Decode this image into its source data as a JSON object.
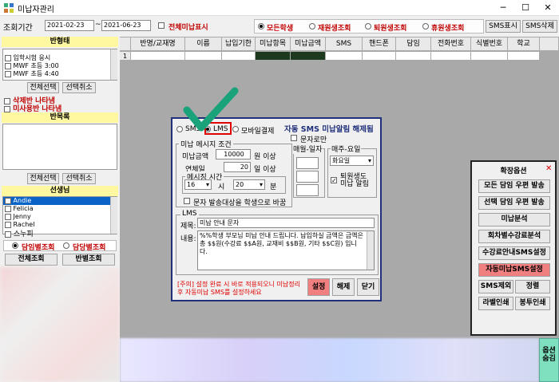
{
  "window": {
    "title": "미납자관리",
    "minimize": "─",
    "maximize": "☐",
    "close": "✕"
  },
  "toolbar": {
    "period_label": "조회기간",
    "date_from": "2021-02-23",
    "date_sep": "~",
    "date_to": "2021-06-23",
    "show_all_unpaid": "전체미납표시",
    "radios": [
      "모든학생",
      "재원생조회",
      "퇴원생조회",
      "휴원생조회"
    ],
    "sms_show": "SMS표시",
    "sms_delete": "SMS삭제"
  },
  "sidebar": {
    "class_header": "반형태",
    "class_items": [
      "입학시험 응시",
      "MWF 초등 3:00",
      "MWF 초등 4:40"
    ],
    "select_all": "전체선택",
    "deselect": "선택취소",
    "deleted_classes": "삭제반 나타냄",
    "unused_classes": "미사용반 나타냄",
    "section_header": "반목록",
    "select_all2": "전체선택",
    "deselect2": "선택취소",
    "teacher_header": "선생님",
    "teachers": [
      "Andie",
      "Felicia",
      "Jenny",
      "Rachel",
      "스누피"
    ],
    "by_teacher": "담임별조회",
    "by_charge": "담당별조회",
    "view_all": "전체조회",
    "by_class": "반별조회"
  },
  "grid": {
    "columns": [
      "반명/교재명",
      "이름",
      "납입기한",
      "미납항목",
      "미납금액",
      "SMS",
      "핸드폰",
      "담임",
      "전화번호",
      "식별번호",
      "학교"
    ],
    "row_num": "1"
  },
  "dialog": {
    "title": "자동 SMS 미납알림 해제됨",
    "radio_sms": "SMS",
    "radio_lms": "LMS",
    "radio_mobile": "모바일결제",
    "text_only": "문자로만",
    "unpaid_group": "미납 메시지 조건",
    "unpaid_amount_label": "미납금액",
    "unpaid_amount": "10000",
    "unpaid_amount_unit": "원 이상",
    "overdue_label": "연체일",
    "overdue_days": "20",
    "overdue_unit": "일 이상",
    "send_time_group": "메시징 시간",
    "hour": "16",
    "hour_unit": "시",
    "minute": "20",
    "minute_unit": "분",
    "send_target": "문자 발송대상을 학생으로 바꿈",
    "monthly_group": "매월-일자",
    "weekly_group": "매주-요일",
    "weekday": "화요일",
    "withdrawn_alert": "퇴원생도 미납 알림",
    "lms_group": "LMS",
    "subject_label": "제목:",
    "subject": "미납 안내 문자",
    "content_label": "내용:",
    "content": "%%학생 부모님 미납 안내 드립니다. 납입하실 금액은 금액은 총 $$원(수강료 $$A원, 교재비 $$B원, 기타 $$C원) 입니다.",
    "notice": "[주의] 설정 완료 시 바로 적용되오니 미납정리 후 자동미납 SMS를 설정하세요",
    "btn_set": "설정",
    "btn_release": "해제",
    "btn_close": "닫기"
  },
  "ext_panel": {
    "title": "확장옵션",
    "close": "✕",
    "buttons": [
      "모든 담임 우편 발송",
      "선택 담임 우편 발송",
      "미납분석",
      "회차별수강료분석",
      "수강료안내SMS설정",
      "자동미납SMS설정",
      "SMS제외",
      "정렬",
      "라벨인쇄",
      "봉투인쇄"
    ]
  },
  "corner": {
    "label": "옵션숨김"
  },
  "colors": {
    "accent": "#1f2f7a",
    "highlight": "#f08080",
    "select": "#0a64c8",
    "check": "#1aa37a"
  }
}
